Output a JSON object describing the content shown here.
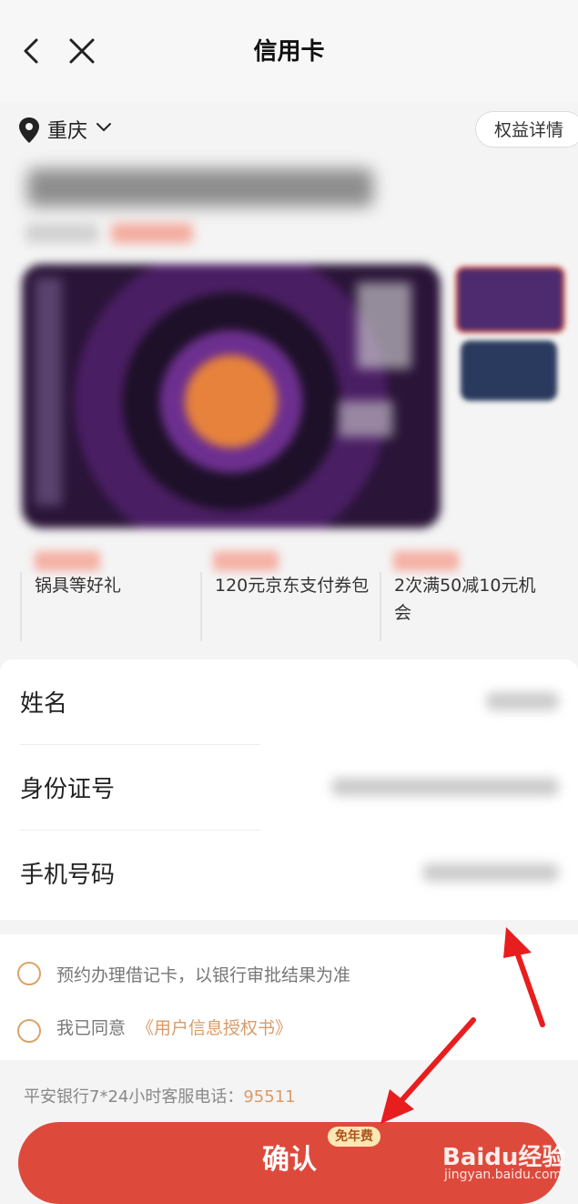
{
  "header": {
    "title": "信用卡"
  },
  "location": {
    "city": "重庆",
    "benefits_button": "权益详情"
  },
  "perks": [
    {
      "text": "锅具等好礼"
    },
    {
      "text": "120元京东支付券包"
    },
    {
      "text": "2次满50减10元机会"
    }
  ],
  "form": {
    "name_label": "姓名",
    "id_label": "身份证号",
    "phone_label": "手机号码"
  },
  "agreements": {
    "reserve_text": "预约办理借记卡，以银行审批结果为准",
    "consent_prefix": "我已同意",
    "consent_link": "《用户信息授权书》"
  },
  "hotline": {
    "label": "平安银行7*24小时客服电话：",
    "number": "95511"
  },
  "confirm": {
    "label": "确认",
    "badge": "免年费"
  },
  "watermark": {
    "logo": "Baidu经验",
    "site": "jingyan.baidu.com"
  },
  "colors": {
    "accent": "#dd4a3c",
    "link": "#d99b6a",
    "radio": "#d9a46a"
  }
}
